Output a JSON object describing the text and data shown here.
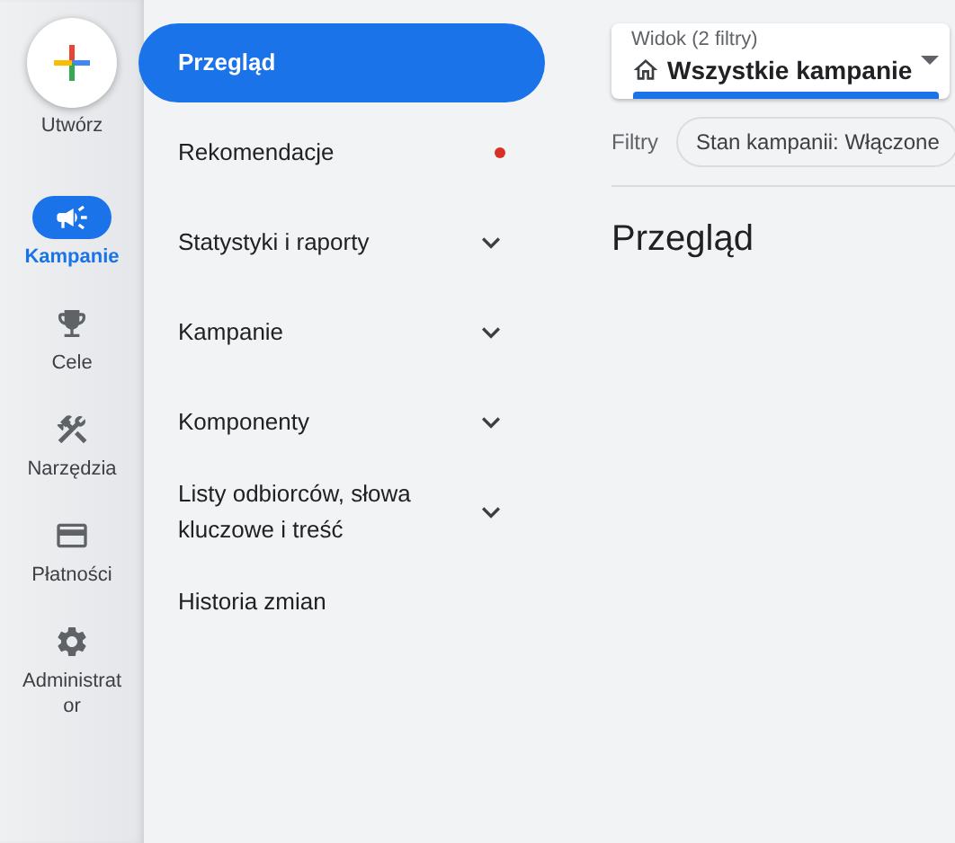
{
  "rail": {
    "create_label": "Utwórz",
    "items": [
      {
        "label": "Kampanie",
        "kind": "campaign",
        "selected": true
      },
      {
        "label": "Cele",
        "kind": "goals",
        "selected": false
      },
      {
        "label": "Narzędzia",
        "kind": "tools",
        "selected": false
      },
      {
        "label": "Płatności",
        "kind": "billing",
        "selected": false
      },
      {
        "label": "Administrator",
        "kind": "admin",
        "selected": false
      }
    ]
  },
  "nav": {
    "items": [
      {
        "label": "Przegląd",
        "kind": "link",
        "selected": true,
        "notification": false
      },
      {
        "label": "Rekomendacje",
        "kind": "link",
        "selected": false,
        "notification": true
      },
      {
        "label": "Statystyki i raporty",
        "kind": "group",
        "selected": false,
        "notification": false,
        "expanded": false
      },
      {
        "label": "Kampanie",
        "kind": "group",
        "selected": false,
        "notification": false,
        "expanded": false
      },
      {
        "label": "Komponenty",
        "kind": "group",
        "selected": false,
        "notification": false,
        "expanded": false
      },
      {
        "label": "Listy odbiorców, słowa kluczowe i treść",
        "kind": "group",
        "selected": false,
        "notification": false,
        "expanded": false
      },
      {
        "label": "Historia zmian",
        "kind": "link",
        "selected": false,
        "notification": false
      }
    ]
  },
  "view_selector": {
    "label": "Widok (2 filtry)",
    "value": "Wszystkie kampanie"
  },
  "filters": {
    "label": "Filtry",
    "chips": [
      "Stan kampanii: Włączone"
    ]
  },
  "page_title": "Przegląd"
}
